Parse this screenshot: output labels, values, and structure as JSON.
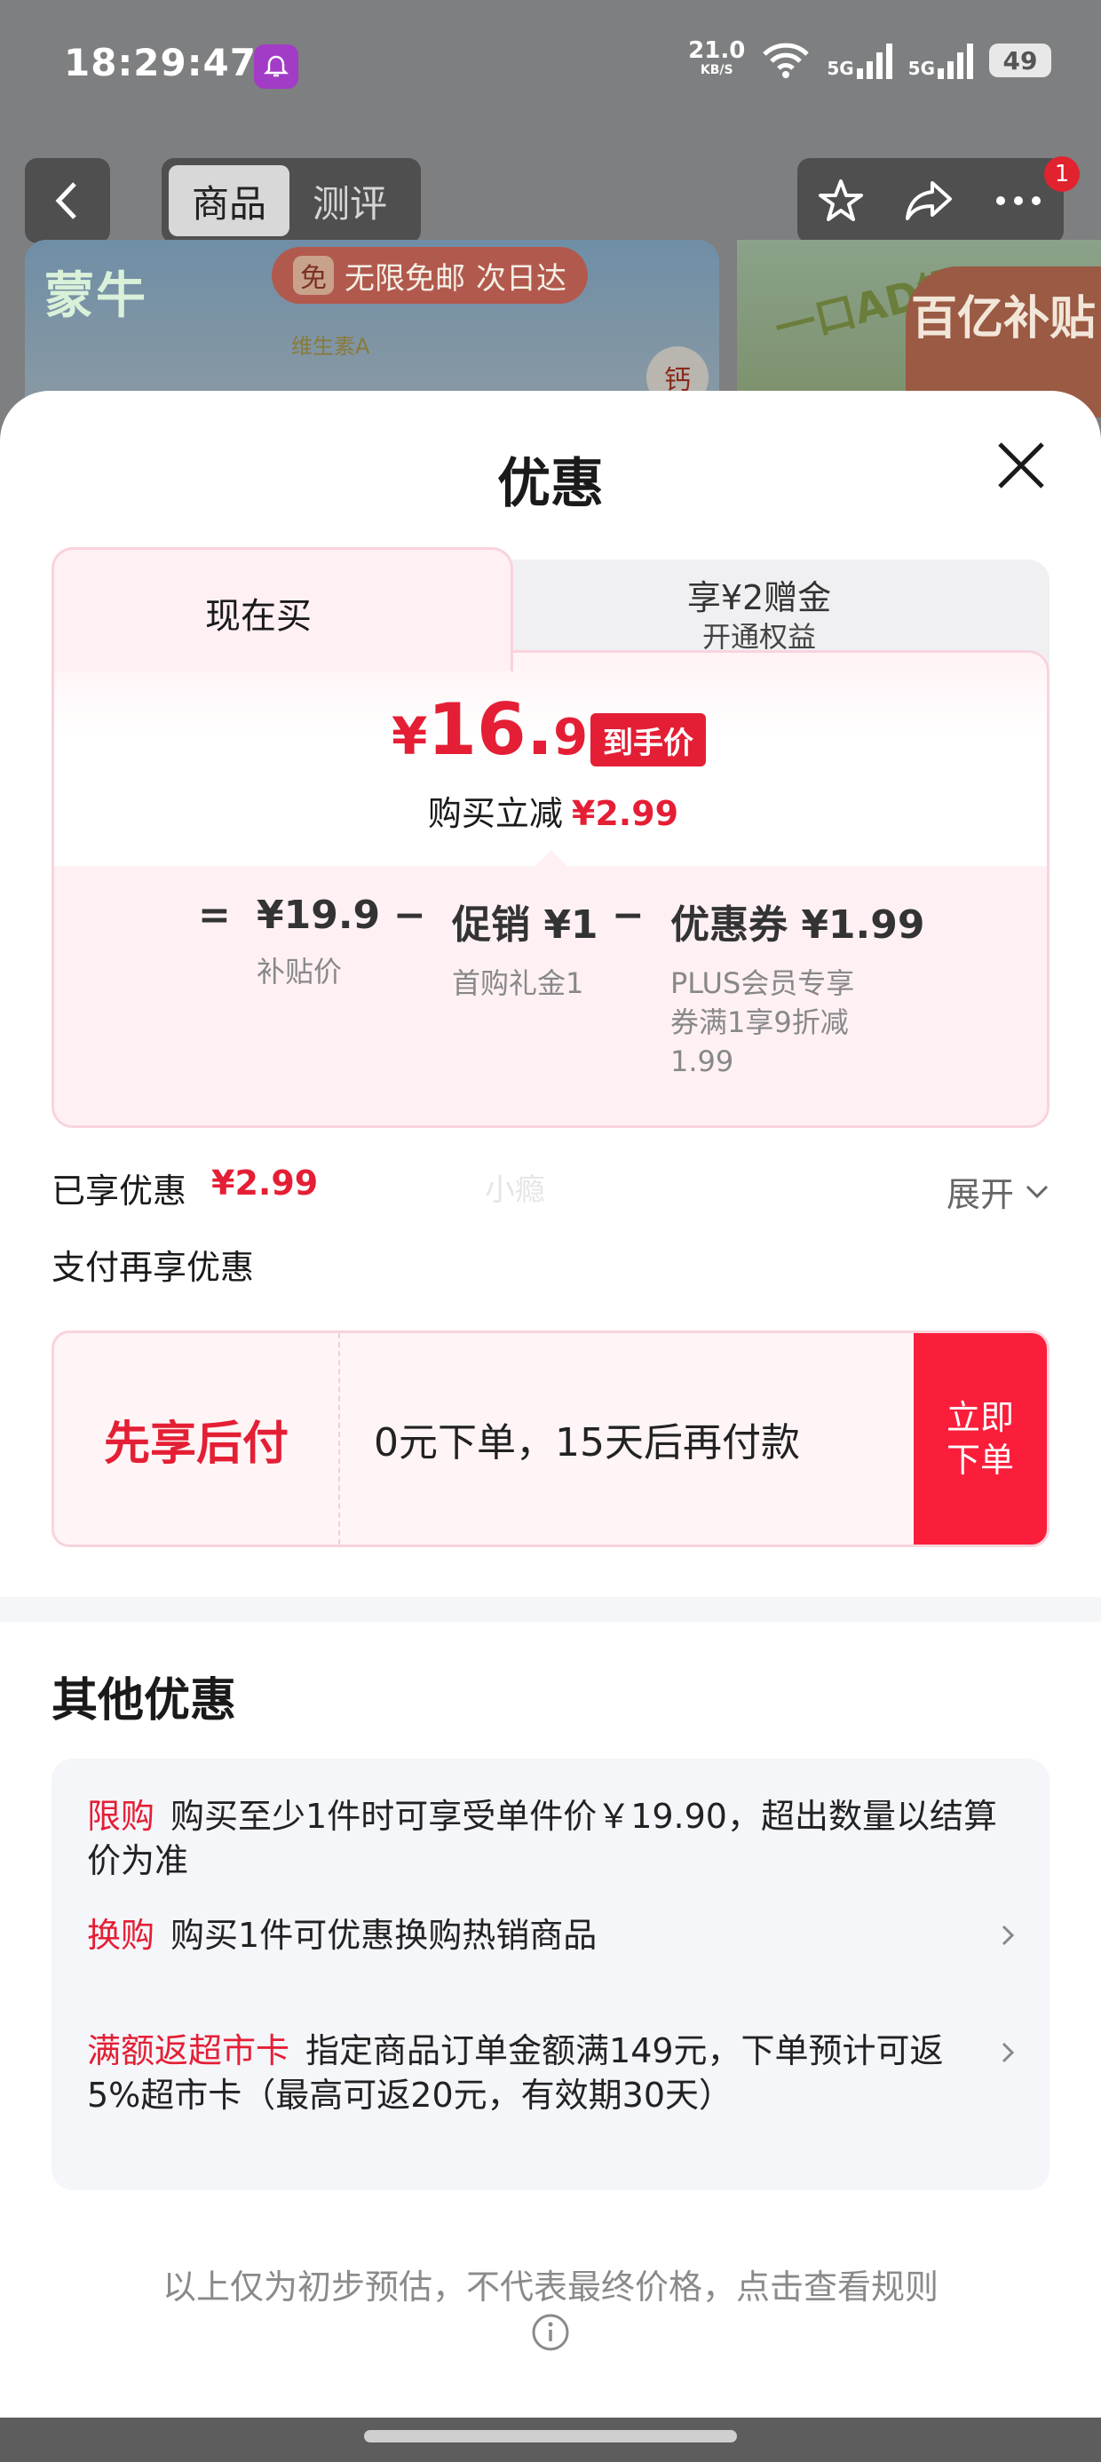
{
  "status_bar": {
    "time": "18:29:47",
    "net_speed": "21.0",
    "net_unit": "KB/S",
    "signal1": "5G",
    "signal2": "5G",
    "battery": "49"
  },
  "nav": {
    "tabs": [
      "商品",
      "测评"
    ],
    "active_tab": "商品",
    "badge": "1",
    "icons": [
      "back-arrow-icon",
      "star-icon",
      "share-icon",
      "more-icon"
    ]
  },
  "banner": {
    "brand": "蒙牛",
    "pill_tag": "免",
    "pill_text": "无限免邮",
    "pill_sub": "次日达",
    "vitamin": "维生素A",
    "calcium": "钙",
    "slogan": "一口AD钙",
    "subsidy": "百亿补贴"
  },
  "sheet": {
    "title": "优惠",
    "tab_now": "现在买",
    "tab_plus_line1": "享¥2赠金",
    "tab_plus_line2": "开通权益",
    "final_price_yen": "¥",
    "final_price_int": "16.",
    "final_price_dec": "91",
    "final_badge": "到手价",
    "reduce_label": "购买立减",
    "reduce_amount": "¥2.99",
    "breakdown": {
      "eq": "=",
      "minus": "−",
      "subsidy_price": "¥19.9",
      "subsidy_label": "补贴价",
      "promo_value": "促销 ¥1",
      "promo_desc": "首购礼金1",
      "coupon_value": "优惠券 ¥1.99",
      "coupon_desc": "PLUS会员专享券满1享9折减1.99"
    },
    "enjoyed_label": "已享优惠",
    "enjoyed_amount": "¥2.99",
    "watermark": "小瘾",
    "expand_label": "展开",
    "pay_label": "支付再享优惠",
    "bnpl": {
      "brand": "先享后付",
      "text": "0元下单，15天后再付款",
      "button": "立即下单"
    },
    "other_title": "其他优惠",
    "offers": [
      {
        "tag": "限购",
        "text": "购买至少1件时可享受单件价￥19.90，超出数量以结算价为准"
      },
      {
        "tag": "换购",
        "text": "购买1件可优惠换购热销商品"
      },
      {
        "tag": "满额返超市卡",
        "text": "指定商品订单金额满149元，下单预计可返5%超市卡（最高可返20元，有效期30天）"
      }
    ],
    "footer_note": "以上仅为初步预估，不代表最终价格，点击查看规则"
  },
  "colors": {
    "accent_red": "#e41f35",
    "button_red": "#fa1e3b",
    "card_pink": "#fff1f3"
  }
}
